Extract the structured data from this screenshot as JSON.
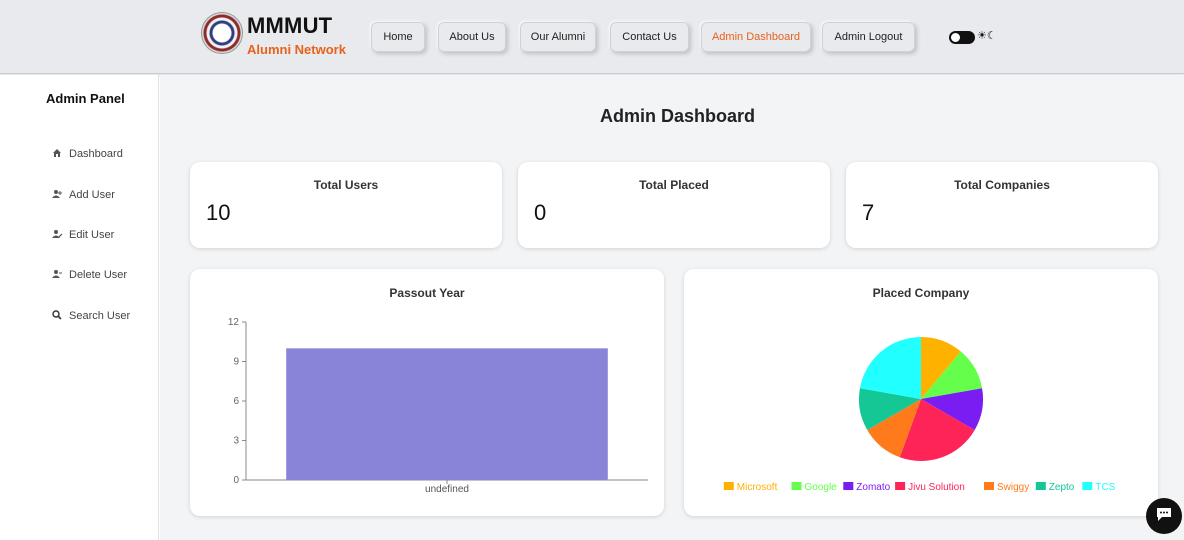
{
  "brand": {
    "title": "MMMUT",
    "subtitle": "Alumni Network",
    "subtitle_color": "#e8621b",
    "logo_icon": "university-seal-icon"
  },
  "nav": {
    "items": [
      {
        "label": "Home"
      },
      {
        "label": "About Us"
      },
      {
        "label": "Our Alumni"
      },
      {
        "label": "Contact Us"
      },
      {
        "label": "Admin Dashboard",
        "active": true
      },
      {
        "label": "Admin Logout"
      }
    ],
    "theme_toggle_icons": "☀☾"
  },
  "sidebar": {
    "title": "Admin Panel",
    "items": [
      {
        "label": "Dashboard",
        "icon": "home-icon"
      },
      {
        "label": "Add User",
        "icon": "user-plus-icon"
      },
      {
        "label": "Edit User",
        "icon": "user-edit-icon"
      },
      {
        "label": "Delete User",
        "icon": "user-minus-icon"
      },
      {
        "label": "Search User",
        "icon": "search-icon"
      }
    ]
  },
  "main": {
    "title": "Admin Dashboard",
    "stats": [
      {
        "label": "Total Users",
        "value": "10"
      },
      {
        "label": "Total Placed",
        "value": "0"
      },
      {
        "label": "Total Companies",
        "value": "7"
      }
    ]
  },
  "chart_data": [
    {
      "type": "bar",
      "title": "Passout Year",
      "categories": [
        "undefined"
      ],
      "values": [
        10
      ],
      "ylim": [
        0,
        12
      ],
      "yticks": [
        "0",
        "3",
        "6",
        "9",
        "12"
      ],
      "color": "#8884d8"
    },
    {
      "type": "pie",
      "title": "Placed Company",
      "legend_position": "bottom",
      "slices": [
        {
          "label": "Microsoft",
          "value": 1,
          "color": "#FFB100"
        },
        {
          "label": "Google",
          "value": 1,
          "color": "#65FF4B"
        },
        {
          "label": "Zomato",
          "value": 1,
          "color": "#7A1DF2"
        },
        {
          "label": "Jivu Solution",
          "value": 2,
          "color": "#FF2457"
        },
        {
          "label": "Swiggy",
          "value": 1,
          "color": "#FF7A1A"
        },
        {
          "label": "Zepto",
          "value": 1,
          "color": "#14C896"
        },
        {
          "label": "TCS",
          "value": 2,
          "color": "#22FFFF"
        }
      ]
    }
  ],
  "chat": {
    "icon": "chat-bubble-icon"
  }
}
